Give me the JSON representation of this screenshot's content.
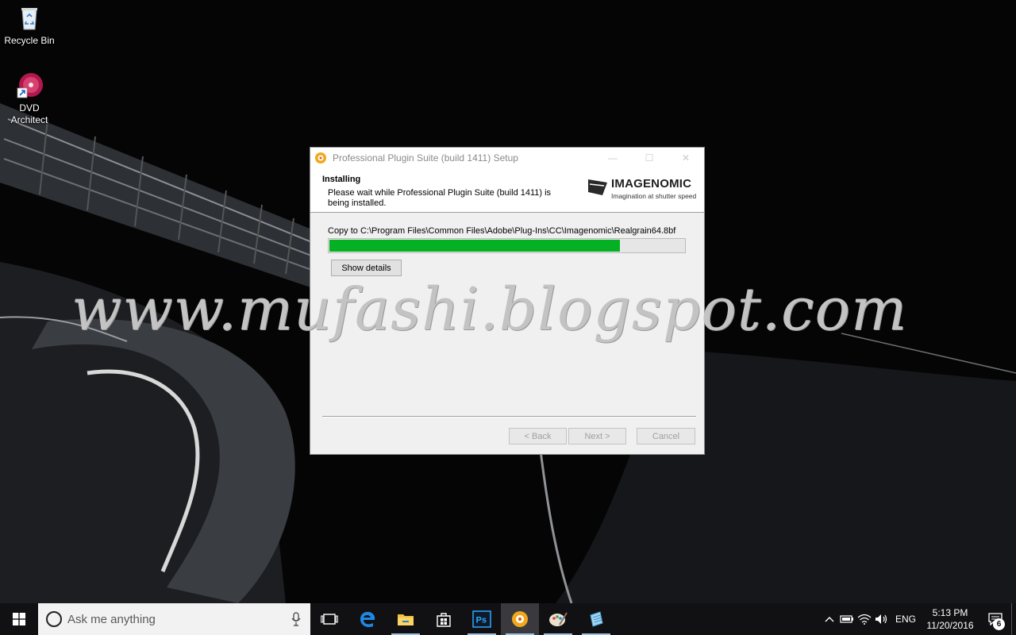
{
  "desktop": {
    "icons": [
      {
        "label": "Recycle Bin",
        "icon": "recycle-bin-icon"
      },
      {
        "label": "DVD Architect",
        "icon": "dvd-architect-icon"
      }
    ]
  },
  "dialog": {
    "title": "Professional Plugin Suite (build 1411) Setup",
    "header_title": "Installing",
    "header_subtitle": "Please wait while Professional Plugin Suite (build 1411) is being installed.",
    "logo": {
      "name": "IMAGENOMIC",
      "tagline": "Imagination at shutter speed"
    },
    "status_text": "Copy to C:\\Program Files\\Common Files\\Adobe\\Plug-Ins\\CC\\Imagenomic\\Realgrain64.8bf",
    "progress": 0.82,
    "progress_color": "#06b025",
    "show_details_label": "Show details",
    "back_label": "< Back",
    "next_label": "Next >",
    "cancel_label": "Cancel"
  },
  "watermark": {
    "text": "www.mufashi.blogspot.com"
  },
  "taskbar": {
    "search_placeholder": "Ask me anything",
    "apps": [
      "task-view-icon",
      "edge-icon",
      "file-explorer-icon",
      "store-icon",
      "photoshop-icon",
      "setup-icon",
      "paint-icon",
      "notepad-icon"
    ],
    "photoshop_label": "Ps",
    "language": "ENG",
    "time": "5:13 PM",
    "date": "11/20/2016",
    "notification_count": "6"
  }
}
